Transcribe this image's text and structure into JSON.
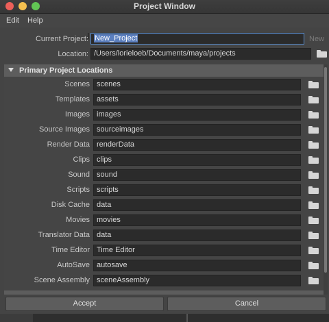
{
  "window": {
    "title": "Project Window"
  },
  "menu": {
    "items": [
      "Edit",
      "Help"
    ]
  },
  "project": {
    "current_label": "Current Project:",
    "current_value": "New_Project",
    "new_label": "New",
    "location_label": "Location:",
    "location_value": "/Users/lorieloeb/Documents/maya/projects"
  },
  "primary_section": {
    "title": "Primary Project Locations",
    "rows": [
      {
        "label": "Scenes",
        "value": "scenes"
      },
      {
        "label": "Templates",
        "value": "assets"
      },
      {
        "label": "Images",
        "value": "images"
      },
      {
        "label": "Source Images",
        "value": "sourceimages"
      },
      {
        "label": "Render Data",
        "value": "renderData"
      },
      {
        "label": "Clips",
        "value": "clips"
      },
      {
        "label": "Sound",
        "value": "sound"
      },
      {
        "label": "Scripts",
        "value": "scripts"
      },
      {
        "label": "Disk Cache",
        "value": "data"
      },
      {
        "label": "Movies",
        "value": "movies"
      },
      {
        "label": "Translator Data",
        "value": "data"
      },
      {
        "label": "Time Editor",
        "value": "Time Editor"
      },
      {
        "label": "AutoSave",
        "value": "autosave"
      },
      {
        "label": "Scene Assembly",
        "value": "sceneAssembly"
      }
    ]
  },
  "buttons": {
    "accept": "Accept",
    "cancel": "Cancel"
  },
  "icons": {
    "folder": "folder-icon",
    "section_toggle": "triangle-down-icon",
    "cursor": "text-cursor-icon"
  },
  "colors": {
    "window_bg": "#444444",
    "field_bg": "#2b2b2b",
    "selection": "#5b7fbf",
    "section_header": "#5d5d5d",
    "close": "#ec5f59",
    "minimize": "#f4bf4f",
    "zoom": "#62c454"
  }
}
